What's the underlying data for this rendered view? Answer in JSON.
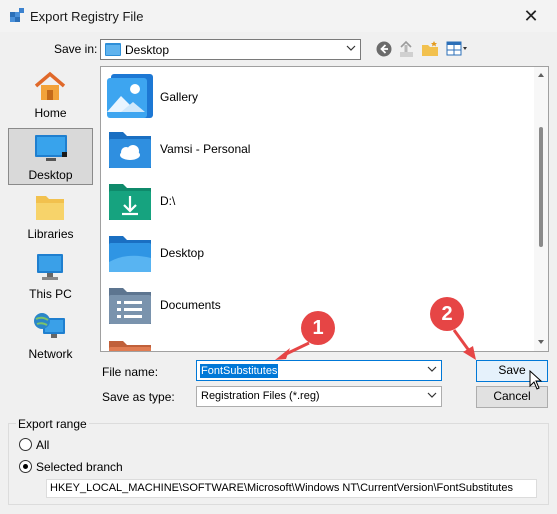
{
  "window": {
    "title": "Export Registry File",
    "close_glyph": "✕",
    "icon": "registry-icon"
  },
  "save_in": {
    "label": "Save in:",
    "value": "Desktop",
    "toolbar_icons": [
      "back-icon",
      "up-folder-icon",
      "new-folder-icon",
      "views-menu-icon"
    ]
  },
  "places": [
    {
      "label": "Home",
      "icon": "home-icon",
      "selected": false
    },
    {
      "label": "Desktop",
      "icon": "desktop-icon",
      "selected": true
    },
    {
      "label": "Libraries",
      "icon": "libraries-icon",
      "selected": false
    },
    {
      "label": "This PC",
      "icon": "this-pc-icon",
      "selected": false
    },
    {
      "label": "Network",
      "icon": "network-icon",
      "selected": false
    }
  ],
  "files": [
    {
      "name": "Gallery",
      "icon": "gallery-icon"
    },
    {
      "name": "Vamsi - Personal",
      "icon": "cloud-folder-icon"
    },
    {
      "name": "D:\\",
      "icon": "download-drive-icon"
    },
    {
      "name": "Desktop",
      "icon": "desktop-folder-icon"
    },
    {
      "name": "Documents",
      "icon": "documents-folder-icon"
    }
  ],
  "form": {
    "filename_label": "File name:",
    "filename_value": "FontSubstitutes",
    "type_label": "Save as type:",
    "type_value": "Registration Files (*.reg)"
  },
  "buttons": {
    "save": "Save",
    "cancel": "Cancel"
  },
  "export_range": {
    "legend": "Export range",
    "option_all": "All",
    "option_branch": "Selected branch",
    "selected": "Selected branch",
    "branch_path": "HKEY_LOCAL_MACHINE\\SOFTWARE\\Microsoft\\Windows NT\\CurrentVersion\\FontSubstitutes"
  },
  "annotations": {
    "badge1": "1",
    "badge2": "2",
    "accent_color": "#e64545"
  },
  "colors": {
    "accent": "#0078d7",
    "folder": "#f2c14e"
  }
}
